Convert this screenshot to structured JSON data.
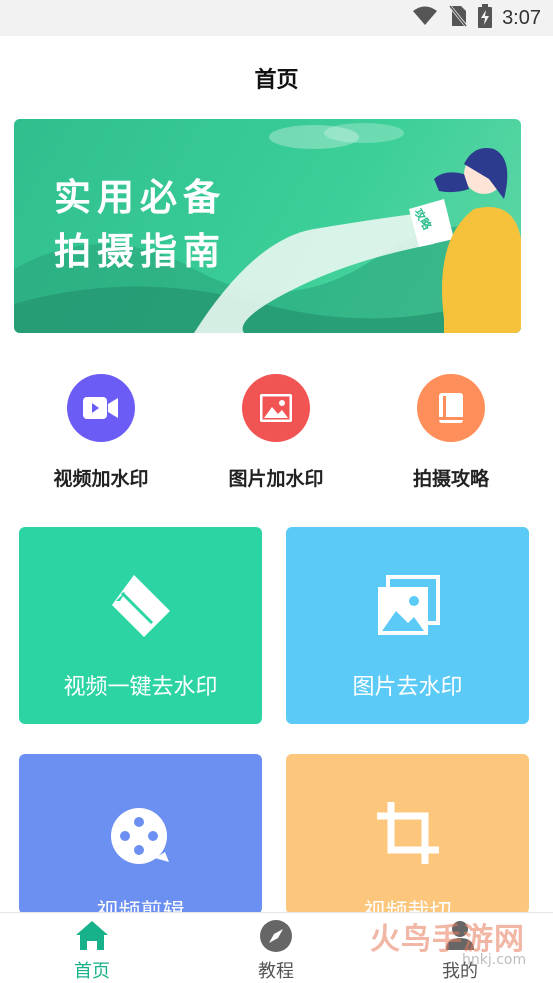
{
  "status_bar": {
    "time": "3:07",
    "icons": [
      "wifi-icon",
      "no-sim-icon",
      "battery-charging-icon"
    ]
  },
  "header": {
    "title": "首页"
  },
  "banner": {
    "line1": "实用必备",
    "line2": "拍摄指南",
    "scroll_text": "攻略"
  },
  "shortcuts": [
    {
      "label": "视频加水印",
      "icon": "video-camera-icon",
      "color": "#6a5cf5"
    },
    {
      "label": "图片加水印",
      "icon": "image-icon",
      "color": "#f25353"
    },
    {
      "label": "拍摄攻略",
      "icon": "book-icon",
      "color": "#ff8f5a"
    }
  ],
  "cards": [
    {
      "label": "视频一键去水印",
      "icon": "eraser-icon",
      "color": "#2cd4a4"
    },
    {
      "label": "图片去水印",
      "icon": "images-icon",
      "color": "#5ccaf6"
    },
    {
      "label": "视频剪辑",
      "icon": "film-reel-icon",
      "color": "#6c8ff2"
    },
    {
      "label": "视频裁切",
      "icon": "crop-icon",
      "color": "#fcc77c"
    }
  ],
  "bottom_nav": [
    {
      "label": "首页",
      "icon": "home-icon",
      "active": true
    },
    {
      "label": "教程",
      "icon": "compass-icon",
      "active": false
    },
    {
      "label": "我的",
      "icon": "profile-icon",
      "active": false
    }
  ],
  "watermark": {
    "text": "火鸟手游网",
    "subtext": "hnkj.com"
  },
  "colors": {
    "accent": "#18b28a",
    "banner_green": "#3ccf98"
  }
}
